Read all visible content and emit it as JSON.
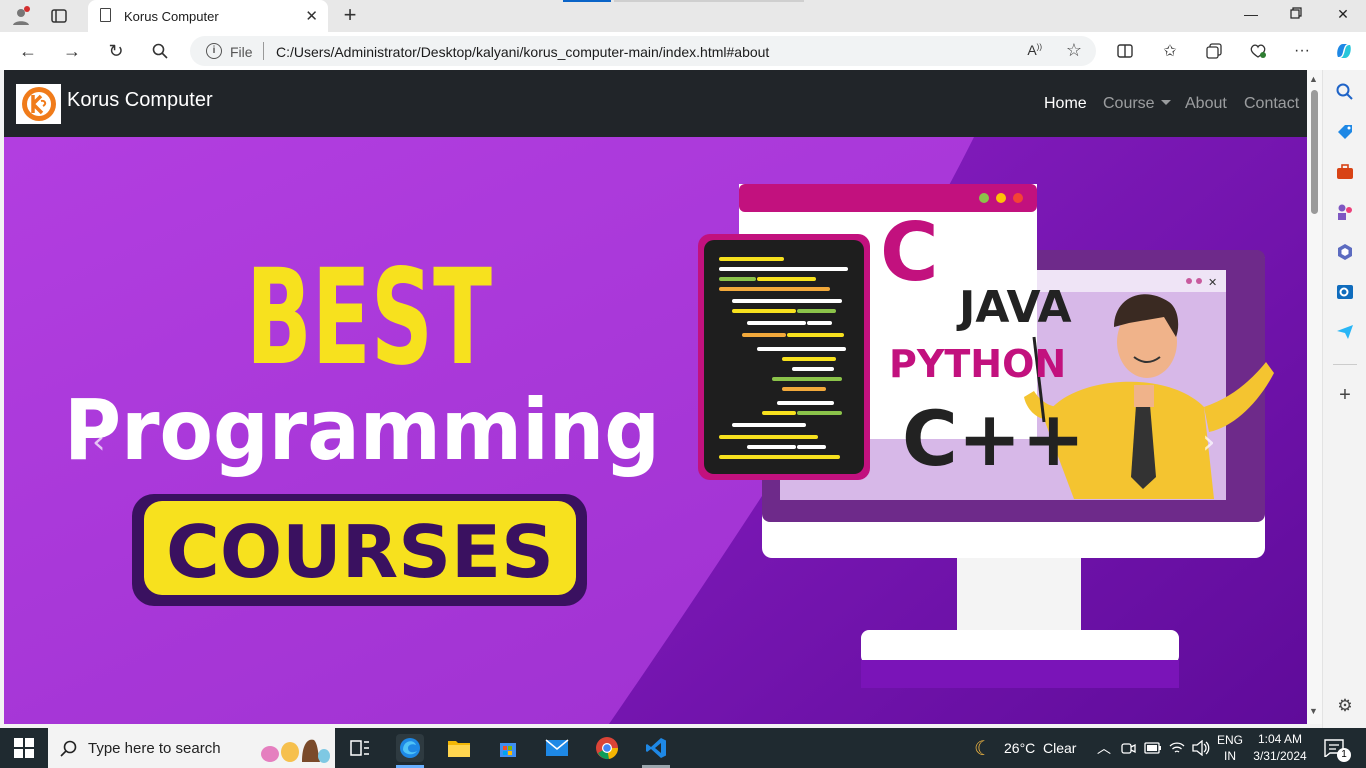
{
  "browser": {
    "tab_title": "Korus Computer",
    "address_scheme": "File",
    "url": "C:/Users/Administrator/Desktop/kalyani/korus_computer-main/index.html#about"
  },
  "site": {
    "brand_name": "Korus Computer",
    "nav": {
      "home": "Home",
      "course": "Course",
      "about": "About",
      "contact": "Contact"
    }
  },
  "banner": {
    "line1": "BEST",
    "line2": "Programming",
    "line3": "COURSES",
    "lang_c": "C",
    "lang_java": "JAVA",
    "lang_python": "PYTHON",
    "lang_cpp": "C++"
  },
  "taskbar": {
    "search_placeholder": "Type here to search",
    "weather_temp": "26°C",
    "weather_desc": "Clear",
    "lang_top": "ENG",
    "lang_bottom": "IN",
    "time": "1:04 AM",
    "date": "3/31/2024",
    "notification_count": "1"
  },
  "colors": {
    "site_nav_bg": "#212529",
    "banner_purple": "#a53ed6",
    "banner_yellow": "#f7e11e",
    "banner_magenta": "#c2117e"
  }
}
